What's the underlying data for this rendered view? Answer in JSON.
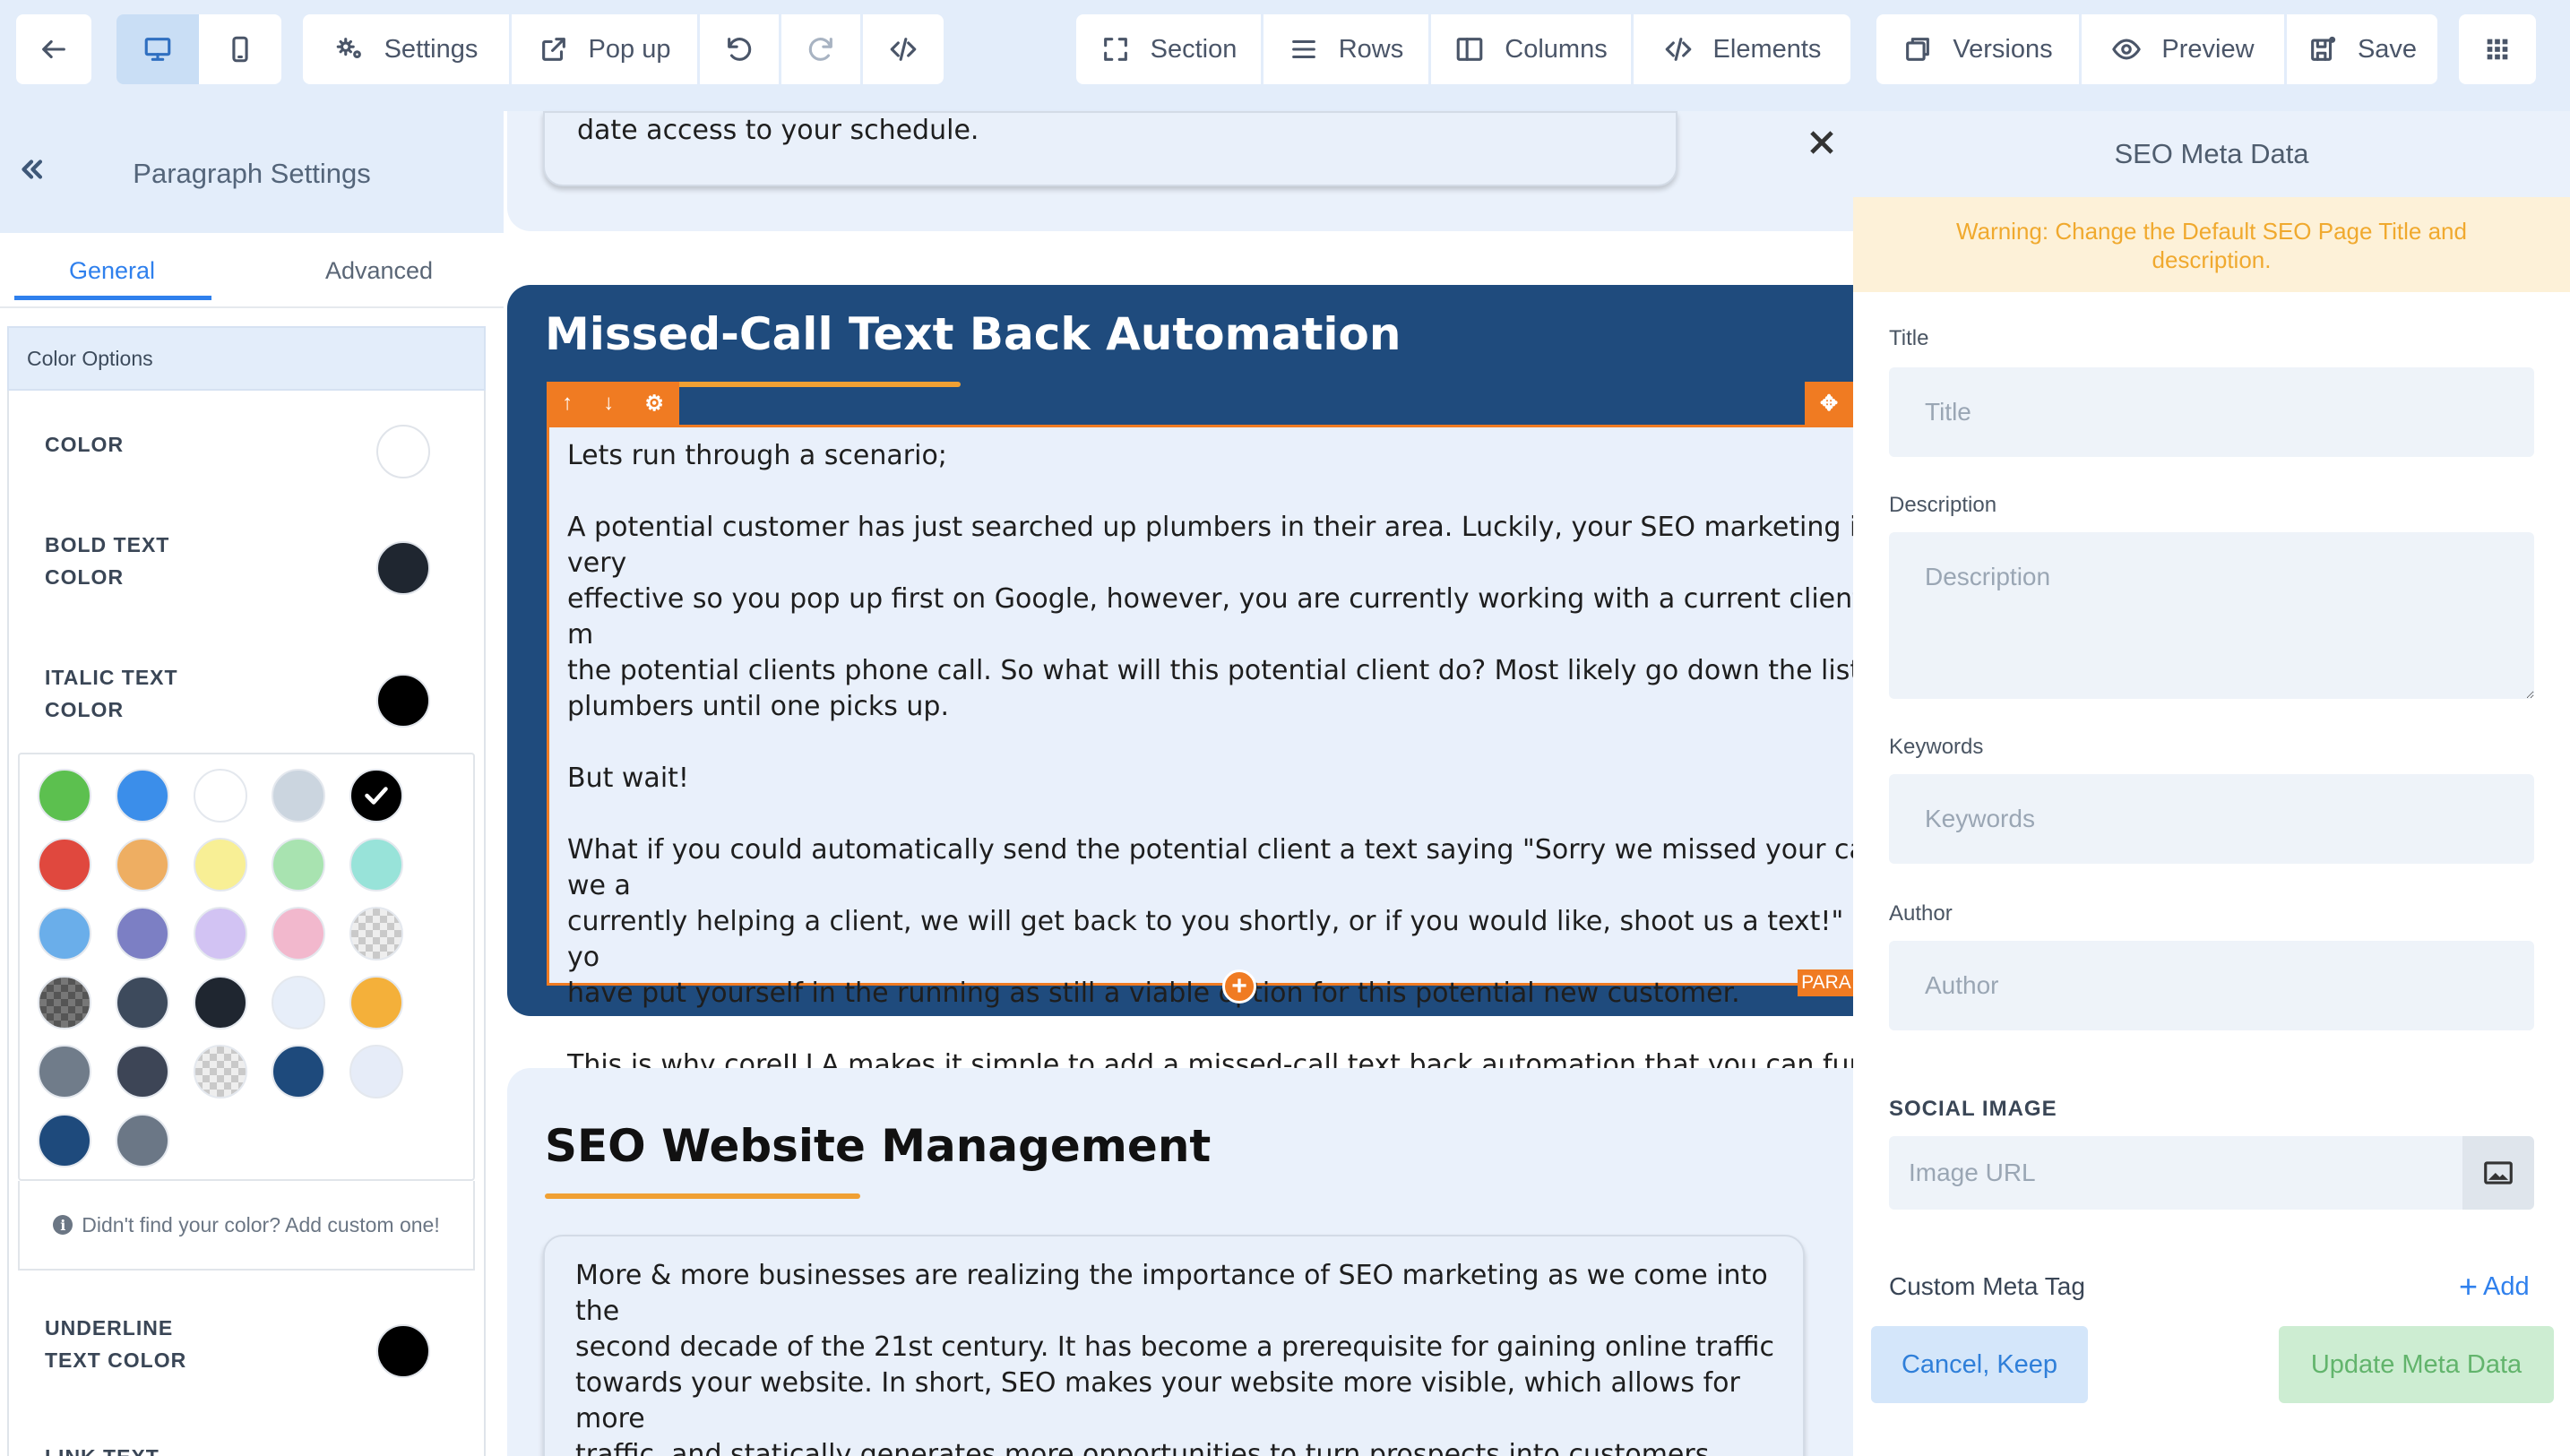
{
  "toolbar": {
    "settings_label": "Settings",
    "popup_label": "Pop up",
    "section_label": "Section",
    "rows_label": "Rows",
    "columns_label": "Columns",
    "elements_label": "Elements",
    "versions_label": "Versions",
    "preview_label": "Preview",
    "save_label": "Save"
  },
  "sidebar": {
    "title": "Paragraph Settings",
    "tabs": [
      {
        "label": "General",
        "active": true
      },
      {
        "label": "Advanced",
        "active": false
      }
    ],
    "color_options_title": "Color Options",
    "color_rows": [
      {
        "label": "COLOR",
        "color": "#ffffff"
      },
      {
        "label": "BOLD TEXT\nCOLOR",
        "color": "#1f2630"
      },
      {
        "label": "ITALIC TEXT\nCOLOR",
        "color": "#000000"
      }
    ],
    "palette": [
      "#5cc04f",
      "#3b8eea",
      "#ffffff",
      "#cbd5df",
      "#000000",
      "#e0483e",
      "#eeae62",
      "#f8ef95",
      "#a8e3b0",
      "#98e3d9",
      "#6aaeea",
      "#7c7fc4",
      "#d2c3f3",
      "#f2b8cd",
      "checker",
      "checker-dark",
      "#3d4a5c",
      "#1f2630",
      "#e7eef9",
      "#f4b03a",
      "#707c8a",
      "#3d4556",
      "checker",
      "#1e4a7c",
      "#e6ecf8",
      "#1e4a7c",
      "#6b7786"
    ],
    "selected_palette_index": 4,
    "custom_color_note": "Didn't find your color? Add custom one!",
    "underline_label": "UNDERLINE\nTEXT COLOR",
    "underline_color": "#000000",
    "link_text_label": "LINK TEXT"
  },
  "canvas": {
    "top_card_text": "date access to your schedule.",
    "blue_section": {
      "title": "Missed-Call Text Back Automation",
      "paragraph": "Lets run through a scenario;\n\nA potential customer has just searched up plumbers in their area. Luckily, your SEO marketing is very\neffective so you pop up first on Google, however, you are currently working with a current client and m\nthe potential clients phone call. So what will this potential client do? Most likely go down the list of\nplumbers until one picks up.\n\nBut wait!\n\nWhat if you could automatically send the potential client a text saying \"Sorry we missed your call, we a\ncurrently helping a client, we will get back to you shortly, or if you would like, shoot us a text!\" Now yo\nhave put yourself in the running as still a viable option for this potential new customer.\n\nThis is why coreILLA makes it simple to add a missed-call text back automation that you can funnel\ndirectly through our app to streamline & capture potential customer communications.",
      "element_tag": "PARA"
    },
    "seo_section": {
      "title": "SEO Website Management",
      "paragraph": "More & more businesses are realizing the importance of SEO marketing as we come into the\nsecond decade of the 21st century. It has become a prerequisite for gaining online traffic\ntowards your website. In short, SEO makes your website more visible, which allows for more\ntraffic, and statically generates more opportunities to turn prospects into customers."
    }
  },
  "seo_panel": {
    "title": "SEO Meta Data",
    "warning": "Warning: Change the Default SEO Page Title and description.",
    "fields": {
      "title_label": "Title",
      "title_placeholder": "Title",
      "title_value": "",
      "description_label": "Description",
      "description_placeholder": "Description",
      "description_value": "",
      "keywords_label": "Keywords",
      "keywords_placeholder": "Keywords",
      "keywords_value": "",
      "author_label": "Author",
      "author_placeholder": "Author",
      "author_value": "",
      "social_image_label": "SOCIAL IMAGE",
      "image_url_placeholder": "Image URL",
      "image_url_value": ""
    },
    "custom_meta_label": "Custom Meta Tag",
    "add_label": "Add",
    "cancel_label": "Cancel, Keep",
    "update_label": "Update Meta Data"
  },
  "colors": {
    "accent": "#2f80ed",
    "brand_navy": "#1f4b7d",
    "orange": "#f07b22",
    "warning_text": "#f0a92e"
  }
}
